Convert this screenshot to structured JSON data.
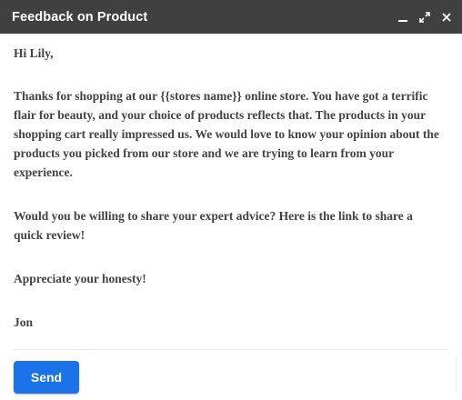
{
  "window": {
    "title": "Feedback on Product",
    "controls": [
      "minimize-icon",
      "expand-icon",
      "close-icon"
    ]
  },
  "email": {
    "greeting": "Hi Lily,",
    "paragraph_1": "Thanks for shopping at our {{stores name}} online store. You have got a terrific flair for beauty, and your choice of products reflects that. The products in your shopping cart really impressed us. We would love to know your opinion about the products you picked from our store and we are trying to learn from your experience.",
    "paragraph_2": "Would you be willing to share your expert advice? Here is the link to share a quick review!",
    "paragraph_3": "Appreciate your honesty!",
    "signature": "Jon"
  },
  "footer": {
    "send_label": "Send"
  },
  "colors": {
    "titlebar": "#404040",
    "send_button": "#1a73e8",
    "body_text": "#444444"
  }
}
